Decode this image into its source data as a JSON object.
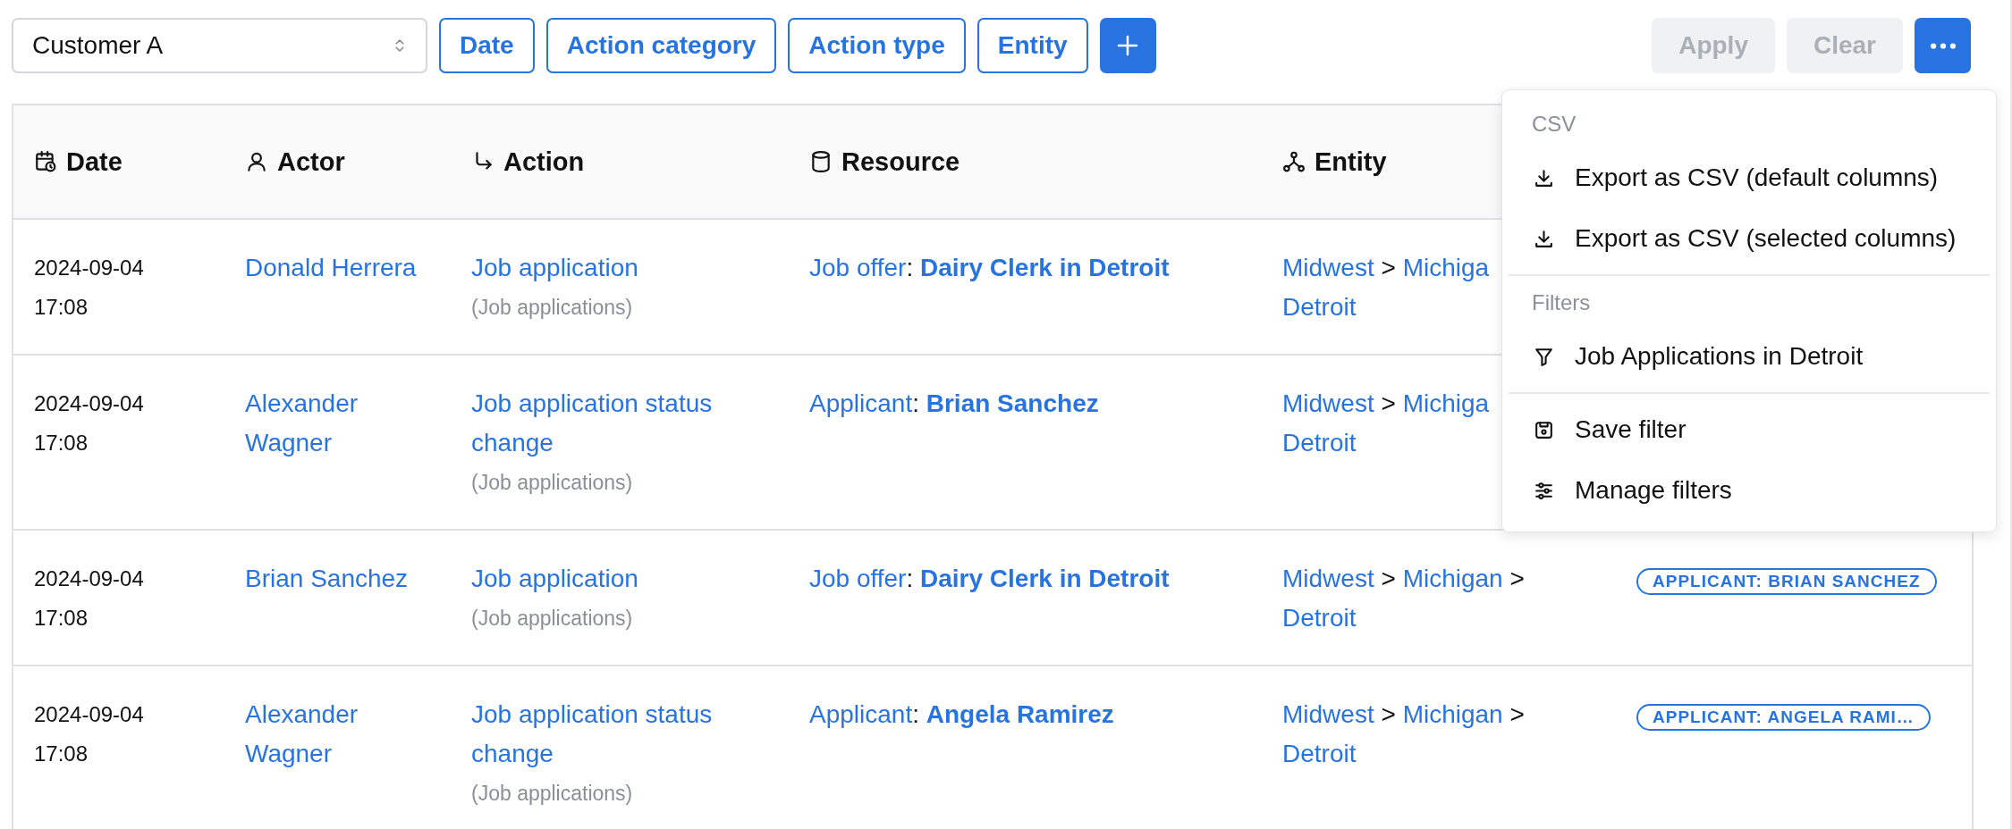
{
  "toolbar": {
    "customer_select": {
      "value": "Customer A"
    },
    "filter_buttons": [
      "Date",
      "Action category",
      "Action type",
      "Entity"
    ],
    "apply": {
      "label": "Apply",
      "disabled": true
    },
    "clear": {
      "label": "Clear",
      "disabled": true
    }
  },
  "table": {
    "columns": [
      "Date",
      "Actor",
      "Action",
      "Resource",
      "Entity"
    ],
    "resource_separator": ":",
    "rows": [
      {
        "date": "2024-09-04",
        "time": "17:08",
        "actor": "Donald Herrera",
        "action": "Job application",
        "action_category": "(Job applications)",
        "resource_type": "Job offer",
        "resource_name": "Dairy Clerk in Detroit",
        "entity": {
          "path": [
            {
              "label": "Midwest",
              "separator": ">"
            },
            {
              "label": "Michiga"
            }
          ],
          "leaf": "Detroit"
        }
      },
      {
        "date": "2024-09-04",
        "time": "17:08",
        "actor": "Alexander Wagner",
        "action": "Job application status change",
        "action_category": "(Job applications)",
        "resource_type": "Applicant",
        "resource_name": "Brian Sanchez",
        "entity": {
          "path": [
            {
              "label": "Midwest",
              "separator": ">"
            },
            {
              "label": "Michiga"
            }
          ],
          "leaf": "Detroit"
        }
      },
      {
        "date": "2024-09-04",
        "time": "17:08",
        "actor": "Brian Sanchez",
        "action": "Job application",
        "action_category": "(Job applications)",
        "resource_type": "Job offer",
        "resource_name": "Dairy Clerk in Detroit",
        "entity": {
          "path": [
            {
              "label": "Midwest",
              "separator": ">"
            },
            {
              "label": "Michigan",
              "separator": ">"
            }
          ],
          "leaf": "Detroit"
        },
        "tag": "APPLICANT: BRIAN SANCHEZ"
      },
      {
        "date": "2024-09-04",
        "time": "17:08",
        "actor": "Alexander Wagner",
        "action": "Job application status change",
        "action_category": "(Job applications)",
        "resource_type": "Applicant",
        "resource_name": "Angela Ramirez",
        "entity": {
          "path": [
            {
              "label": "Midwest",
              "separator": ">"
            },
            {
              "label": "Michigan",
              "separator": ">"
            }
          ],
          "leaf": "Detroit"
        },
        "tag": "APPLICANT: ANGELA RAMI…"
      }
    ]
  },
  "menu": {
    "sections": [
      {
        "heading": "CSV",
        "items": [
          {
            "kind": "export",
            "label": "Export as CSV (default columns)"
          },
          {
            "kind": "export",
            "label": "Export as CSV (selected columns)"
          }
        ]
      },
      {
        "heading": "Filters",
        "items": [
          {
            "kind": "filter",
            "label": "Job Applications in Detroit"
          }
        ]
      },
      {
        "items": [
          {
            "kind": "save",
            "label": "Save filter"
          },
          {
            "kind": "manage",
            "label": "Manage filters"
          }
        ]
      }
    ]
  }
}
